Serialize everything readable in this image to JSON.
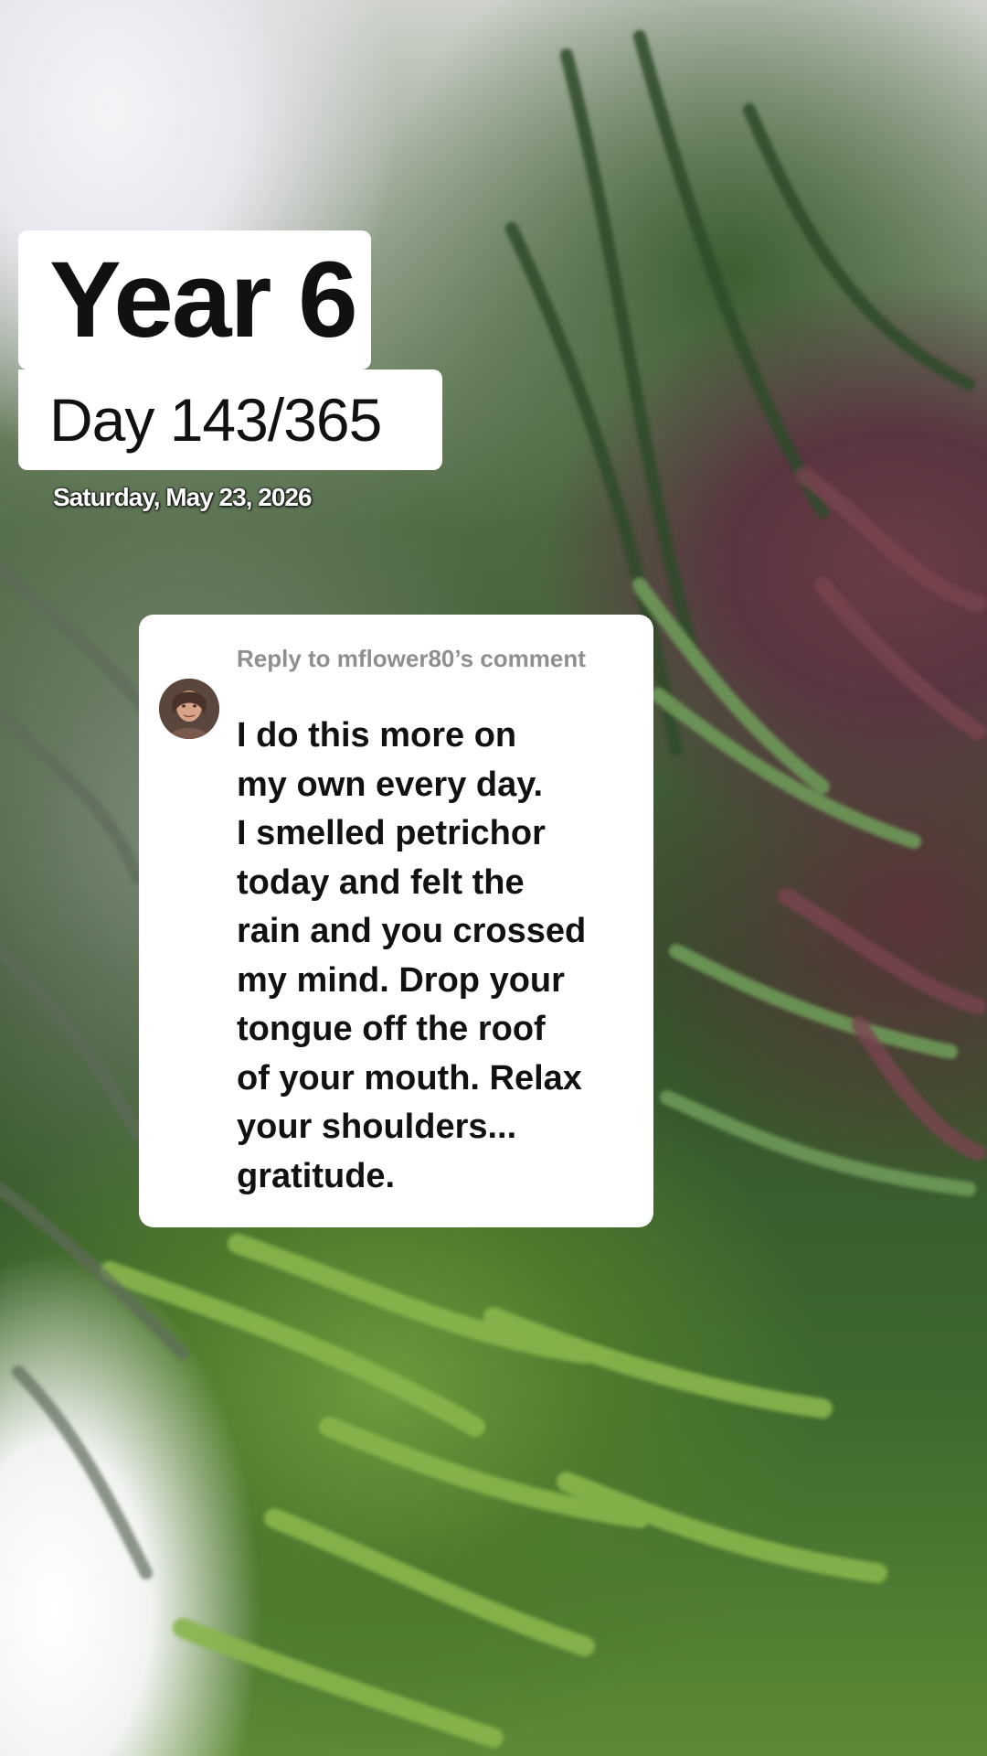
{
  "overlay": {
    "year_label": "Year 6",
    "day_label": "Day 143/365",
    "date_text": "Saturday, May 23, 2026"
  },
  "reply": {
    "header": "Reply to mflower80’s comment",
    "avatar_icon": "user-avatar-icon",
    "lines": [
      "I do this more on",
      "my own every day.",
      "I smelled petrichor",
      "today and felt the",
      "rain and you crossed",
      "my mind. Drop your",
      "tongue off the roof",
      "of your mouth. Relax",
      "your shoulders...",
      "gratitude."
    ]
  },
  "colors": {
    "card_background": "#ffffff",
    "reply_header_text": "#8f8f8f",
    "body_text": "#111111"
  }
}
